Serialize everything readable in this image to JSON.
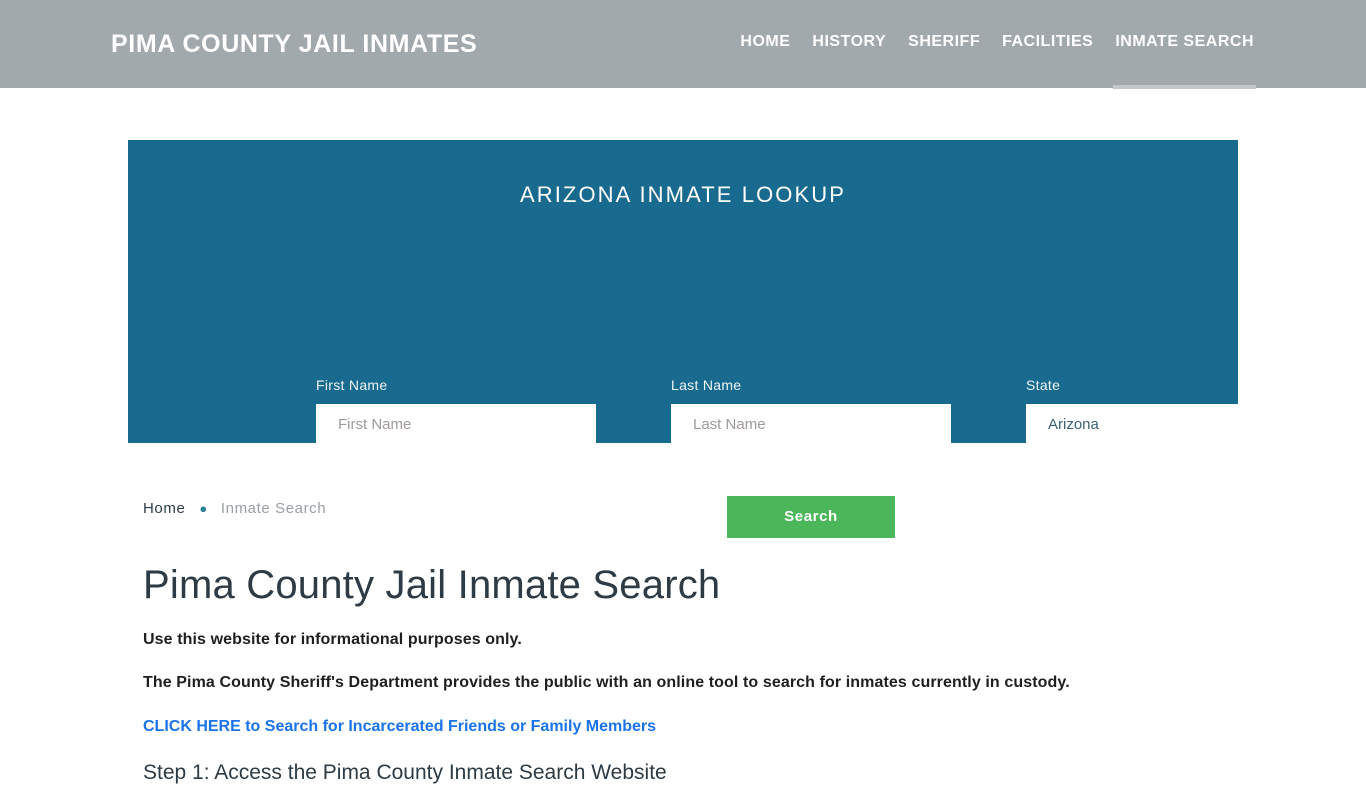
{
  "header": {
    "brand": "PIMA COUNTY JAIL INMATES",
    "nav": [
      {
        "label": "HOME",
        "active": false
      },
      {
        "label": "HISTORY",
        "active": false
      },
      {
        "label": "SHERIFF",
        "active": false
      },
      {
        "label": "FACILITIES",
        "active": false
      },
      {
        "label": "INMATE SEARCH",
        "active": true
      }
    ],
    "background_color": "#a2a9ac"
  },
  "lookup": {
    "title": "ARIZONA INMATE LOOKUP",
    "panel_color": "#186a8e",
    "fields": {
      "first_name": {
        "label": "First Name",
        "placeholder": "First Name",
        "value": ""
      },
      "last_name": {
        "label": "Last Name",
        "placeholder": "Last Name",
        "value": ""
      },
      "state": {
        "label": "State",
        "placeholder": "State",
        "value": "Arizona"
      }
    },
    "search_button": {
      "label": "Search",
      "color": "#4cb75a"
    }
  },
  "breadcrumb": {
    "home": "Home",
    "separator": "●",
    "current": "Inmate Search"
  },
  "main": {
    "title": "Pima County Jail Inmate Search",
    "paragraph_1": "Use this website for informational purposes only.",
    "paragraph_2": "The Pima County Sheriff's Department provides the public with an online tool to search for inmates currently in custody.",
    "link_text": "CLICK HERE to Search for Incarcerated Friends or Family Members",
    "link_color": "#1a73e8",
    "step_1_heading": "Step 1: Access the Pima County Inmate Search Website"
  }
}
